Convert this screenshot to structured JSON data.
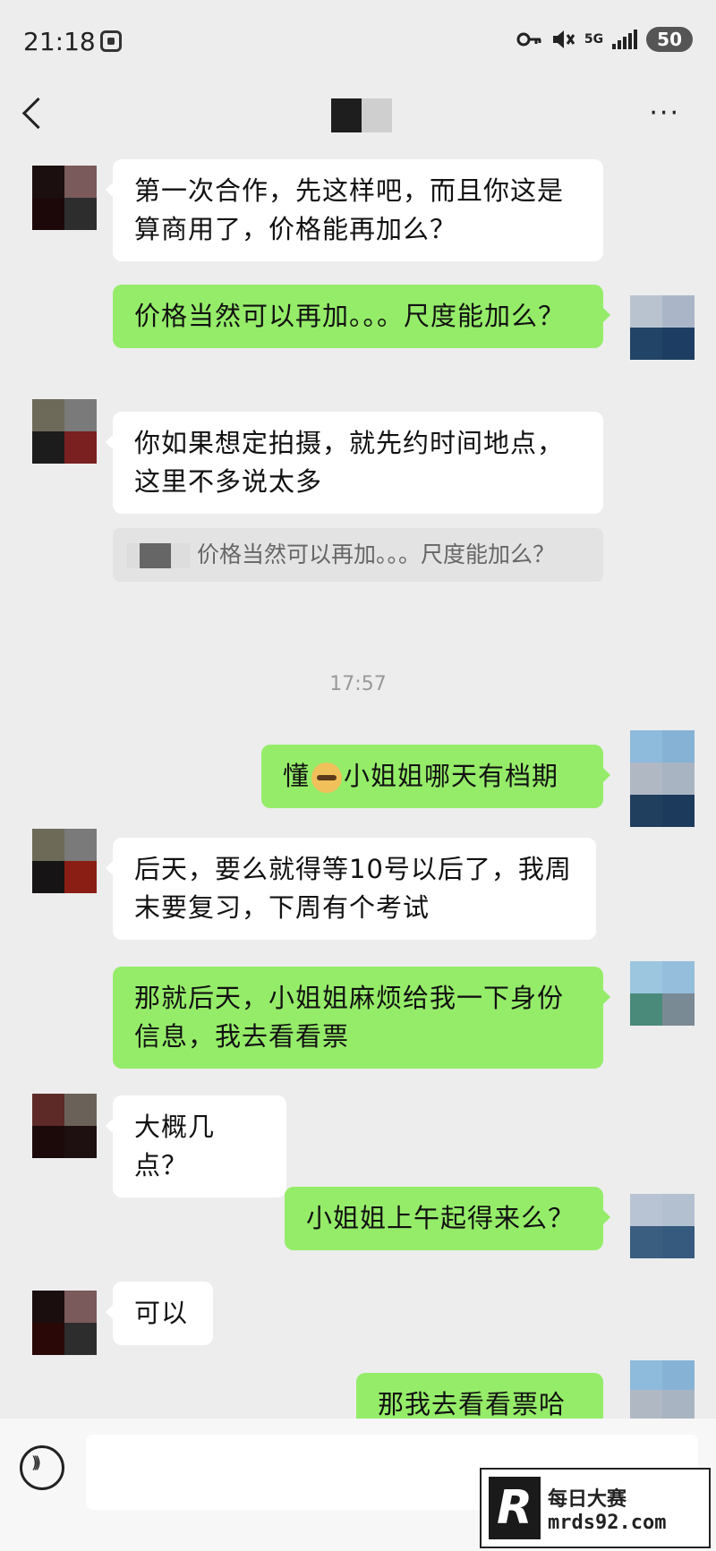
{
  "status": {
    "time": "21:18",
    "net": "5G",
    "battery": "50"
  },
  "header": {
    "more": "···"
  },
  "messages": [
    {
      "text": "第一次合作，先这样吧，而且你这是算商用了，价格能再加么？"
    },
    {
      "text": "价格当然可以再加。。。尺度能加么？"
    },
    {
      "text": "你如果想定拍摄，就先约时间地点，这里不多说太多"
    },
    {
      "quote": "价格当然可以再加。。。尺度能加么？"
    },
    {
      "text_a": "懂",
      "text_b": "小姐姐哪天有档期"
    },
    {
      "text": "后天，要么就得等10号以后了，我周末要复习，下周有个考试"
    },
    {
      "text": "那就后天，小姐姐麻烦给我一下身份信息，我去看看票"
    },
    {
      "text": "大概几点？"
    },
    {
      "text": "小姐姐上午起得来么？"
    },
    {
      "text": "可以"
    },
    {
      "text": "那我去看看票哈"
    }
  ],
  "timestamp": "17:57",
  "watermark": {
    "logo": "R",
    "title": "每日大赛",
    "url": "mrds92.com"
  }
}
